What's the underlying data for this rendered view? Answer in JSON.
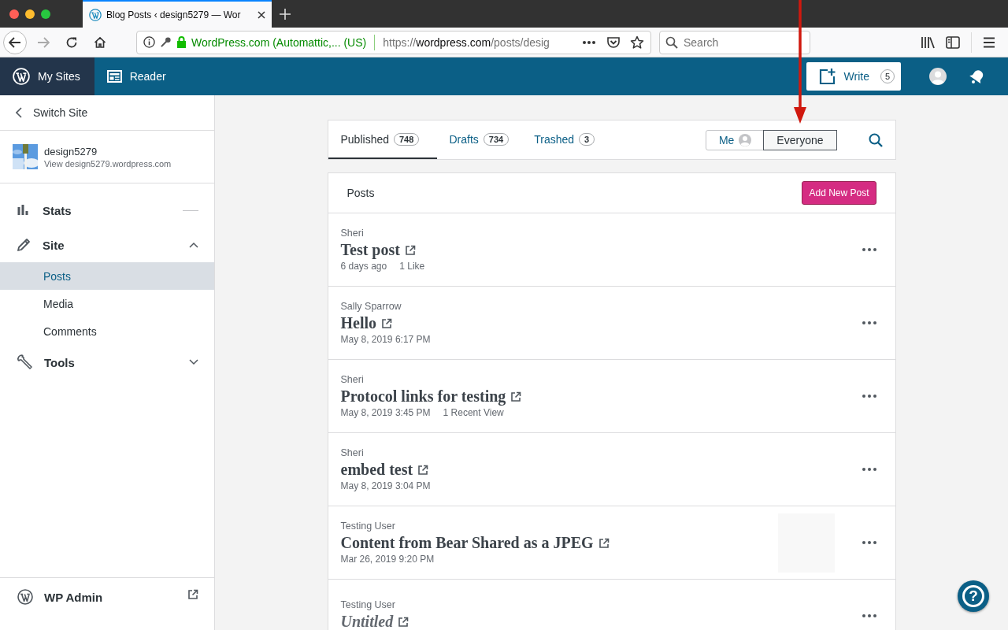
{
  "browser": {
    "tab_title": "Blog Posts ‹ design5279 — Wor",
    "identity": "WordPress.com (Automattic,...  (US)",
    "url_scheme": "https://",
    "url_host": "wordpress.com",
    "url_path": "/posts/desig",
    "search": {
      "placeholder": "Search"
    }
  },
  "masterbar": {
    "items": [
      {
        "label": "My Sites",
        "selected": true
      },
      {
        "label": "Reader",
        "selected": false
      }
    ],
    "write": {
      "label": "Write",
      "count": "5"
    }
  },
  "sidebar": {
    "switch_site": "Switch Site",
    "site": {
      "name": "design5279",
      "url": "View design5279.wordpress.com"
    },
    "sections": [
      {
        "label": "Stats",
        "kind": "link"
      },
      {
        "label": "Site",
        "kind": "group",
        "expanded": true,
        "children": [
          {
            "label": "Posts",
            "selected": true
          },
          {
            "label": "Media",
            "selected": false
          },
          {
            "label": "Comments",
            "selected": false
          }
        ]
      },
      {
        "label": "Tools",
        "kind": "group",
        "expanded": false
      }
    ],
    "footer": "WP Admin"
  },
  "posts": {
    "tabs": [
      {
        "label": "Published",
        "count": "748",
        "selected": true
      },
      {
        "label": "Drafts",
        "count": "734",
        "selected": false
      },
      {
        "label": "Trashed",
        "count": "3",
        "selected": false
      }
    ],
    "author_filter": [
      {
        "label": "Me",
        "selected": false
      },
      {
        "label": "Everyone",
        "selected": true
      }
    ],
    "header": "Posts",
    "add_button": "Add New Post",
    "items": [
      {
        "author": "Sheri",
        "title": "Test post",
        "untitled": false,
        "date": "6 days ago",
        "meta": "1 Like"
      },
      {
        "author": "Sally Sparrow",
        "title": "Hello",
        "untitled": false,
        "date": "May 8, 2019 6:17 PM"
      },
      {
        "author": "Sheri",
        "title": "Protocol links for testing",
        "untitled": false,
        "date": "May 8, 2019 3:45 PM",
        "meta": "1 Recent View"
      },
      {
        "author": "Sheri",
        "title": "embed test",
        "untitled": false,
        "date": "May 8, 2019 3:04 PM"
      },
      {
        "author": "Testing User",
        "title": "Content from Bear Shared as a JPEG",
        "untitled": false,
        "date": "Mar 26, 2019 9:20 PM",
        "thumbnail": true
      },
      {
        "author": "Testing User",
        "title": "Untitled",
        "untitled": true
      }
    ]
  },
  "help_button": "?"
}
